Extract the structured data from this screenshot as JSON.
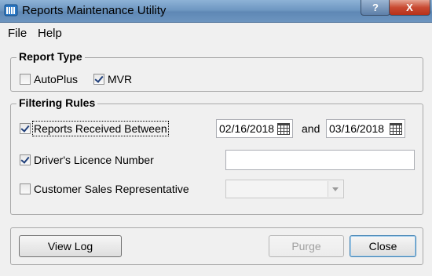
{
  "window": {
    "title": "Reports Maintenance Utility",
    "help_button": "?",
    "close_button": "X"
  },
  "menu": {
    "file": "File",
    "help": "Help"
  },
  "report_type": {
    "title": "Report Type",
    "autoplus": {
      "label": "AutoPlus",
      "checked": false
    },
    "mvr": {
      "label": "MVR",
      "checked": true
    }
  },
  "filtering": {
    "title": "Filtering Rules",
    "received_between": {
      "label": "Reports Received Between",
      "checked": true,
      "from": "02/16/2018",
      "and_label": "and",
      "to": "03/16/2018"
    },
    "licence": {
      "label": "Driver's Licence Number",
      "checked": true,
      "value": ""
    },
    "rep": {
      "label": "Customer Sales Representative",
      "checked": false,
      "value": ""
    }
  },
  "buttons": {
    "view_log": "View Log",
    "purge": "Purge",
    "close": "Close"
  }
}
